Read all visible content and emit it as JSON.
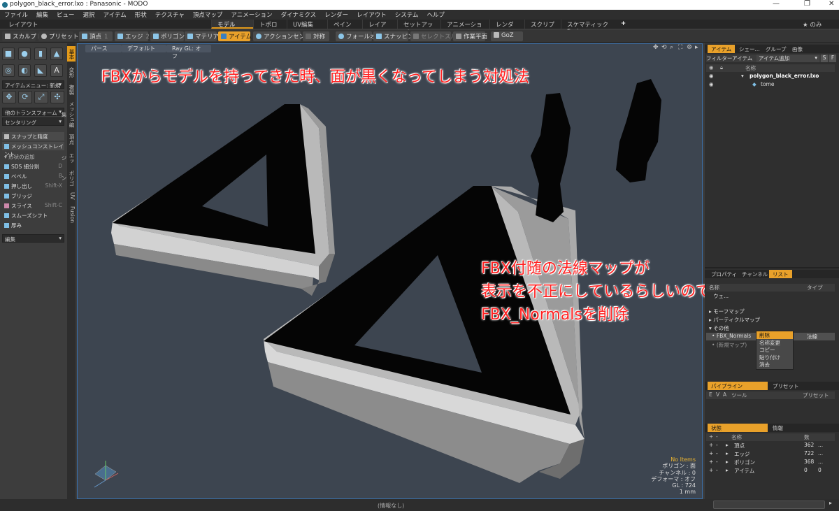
{
  "window": {
    "title": "polygon_black_error.lxo : Panasonic - MODO",
    "minimize": "—",
    "maximize": "❐",
    "close": "✕"
  },
  "menu": [
    "ファイル",
    "編集",
    "ビュー",
    "選択",
    "アイテム",
    "形状",
    "テクスチャ",
    "頂点マップ",
    "アニメーション",
    "ダイナミクス",
    "レンダー",
    "レイアウト",
    "システム",
    "ヘルプ"
  ],
  "layout_bar": {
    "left": "レイアウト",
    "tabs": [
      "モデル",
      "トポロジ",
      "UV編集",
      "ペイント",
      "レイアウト",
      "セットアップ",
      "アニメーション",
      "レンダー",
      "スクリプト",
      "スケマティックFusion"
    ],
    "active_tab": "モデル",
    "add": "+",
    "right": "★ のみ"
  },
  "toolbar": {
    "left": [
      "スカルプト",
      "プリセット"
    ],
    "modes": [
      {
        "label": "頂点",
        "num": "1"
      },
      {
        "label": "エッジ",
        "num": "2"
      },
      {
        "label": "ポリゴン",
        "num": "3"
      },
      {
        "label": "マテリアル",
        "num": ""
      },
      {
        "label": "アイテム",
        "num": ""
      }
    ],
    "active_mode": "アイテム",
    "tools": [
      "アクションセンター",
      "対称",
      "フォールオフ",
      "スナッピング",
      "セレクトスルー",
      "作業平面",
      "GoZ"
    ]
  },
  "left_panel": {
    "vertical_tabs": [
      "基本",
      "変形",
      "複製",
      "メッシュ編集",
      "頂点",
      "エッジ",
      "ポリゴン",
      "UV",
      "Fusion"
    ],
    "active_vtab": "基本",
    "item_menu": "アイテムメニュー: 新規 ...",
    "transform_menu": "他のトランスフォーム",
    "centering_menu": "センタリング",
    "snap": "スナップと精度",
    "mesh_constraint": "メッシュコンストレイント",
    "add_shape_header": "形状の追加",
    "tools": [
      {
        "label": "SDS 細分割",
        "key": "D"
      },
      {
        "label": "ベベル",
        "key": "B"
      },
      {
        "label": "押し出し",
        "key": "Shift-X"
      },
      {
        "label": "ブリッジ",
        "key": ""
      },
      {
        "label": "スライス",
        "key": "Shift-C"
      },
      {
        "label": "スムーズシフト",
        "key": ""
      },
      {
        "label": "厚み",
        "key": ""
      }
    ],
    "edit_menu": "編集"
  },
  "viewport": {
    "view_type": "パース",
    "shading": "デフォルト",
    "raygl": "Ray GL: オフ",
    "overlay_title": "FBXからモデルを持ってきた時、面が黒くなってしまう対処法",
    "overlay_lines": [
      "FBX付随の法線マップが",
      "表示を不正にしているらしいので",
      "FBX_Normalsを削除"
    ],
    "info": [
      "No Items",
      "ポリゴン : 面",
      "チャンネル : 0",
      "デフォーマ : オフ",
      "GL : 724",
      "1 mm"
    ]
  },
  "status_bar": "(情報なし)",
  "right_panel": {
    "top_tabs": [
      "アイテム",
      "シェー...",
      "グループ",
      "画像"
    ],
    "active_top_tab": "アイテム",
    "filter": "フィルターアイテム",
    "add_item": "アイテム追加",
    "name_header": "名称",
    "scene_file": "polygon_black_error.lxo",
    "mesh_name": "tome",
    "mid_tabs": [
      "プロパティ",
      "チャンネル",
      "リスト"
    ],
    "active_mid_tab": "リスト",
    "list_headers": [
      "名称",
      "タイプ"
    ],
    "list_rows": [
      "ウェ...",
      "モーフマップ",
      "パーティクルマップ",
      "その他"
    ],
    "selected_row": {
      "name": "FBX_Normals",
      "type": "法線"
    },
    "new_map": "(新規マップ)",
    "context_menu": [
      "削除",
      "名称変更",
      "コピー",
      "貼り付け",
      "消去"
    ],
    "pipeline_tabs": [
      "パイプライン",
      "プリセット"
    ],
    "pipeline_headers": [
      "E",
      "V",
      "A",
      "ツール",
      "プリセット"
    ],
    "stats_tabs": [
      "状態",
      "情報"
    ],
    "stats_headers": [
      "名称",
      "数"
    ],
    "stats": [
      {
        "name": "頂点",
        "count": "362",
        "more": "..."
      },
      {
        "name": "エッジ",
        "count": "722",
        "more": "..."
      },
      {
        "name": "ポリゴン",
        "count": "368",
        "more": "..."
      },
      {
        "name": "アイテム",
        "count": "0",
        "more": "0"
      }
    ]
  }
}
